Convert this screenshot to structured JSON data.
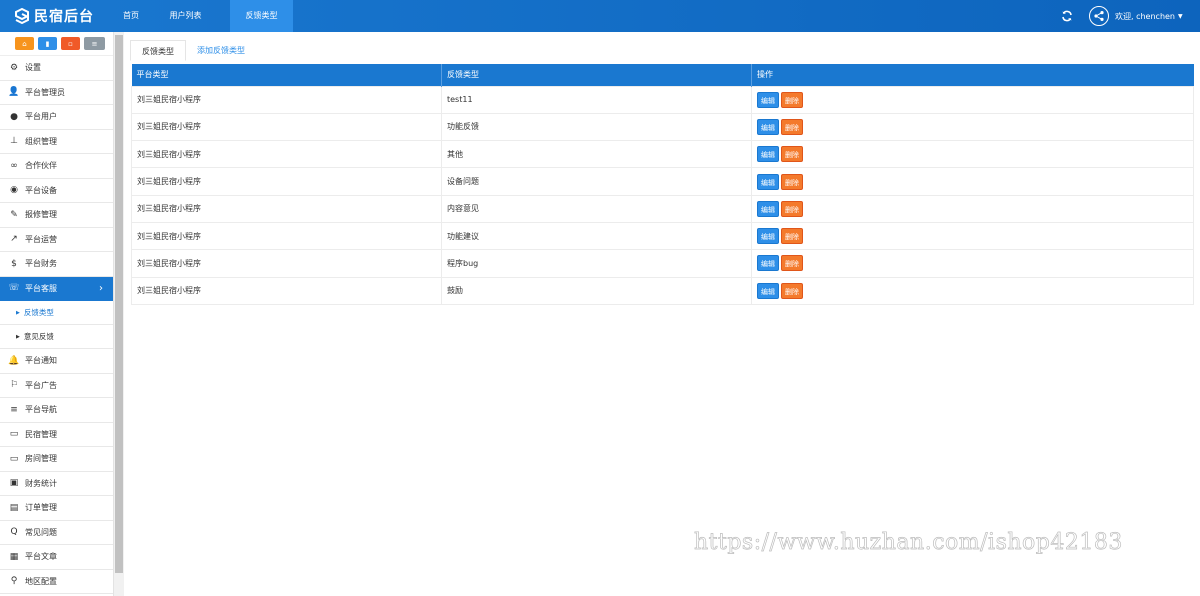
{
  "header": {
    "logo_text": "民宿后台",
    "nav": [
      {
        "label": "首页"
      },
      {
        "label": "用户列表"
      },
      {
        "label": "反馈类型"
      }
    ],
    "welcome": "欢迎, chenchen"
  },
  "sidebar": {
    "quick_buttons": [
      "home-icon",
      "file-icon",
      "trash-icon",
      "list-icon"
    ],
    "items": [
      {
        "label": "设置",
        "icon": "gears-icon"
      },
      {
        "label": "平台管理员",
        "icon": "user-add-icon"
      },
      {
        "label": "平台用户",
        "icon": "user-icon"
      },
      {
        "label": "组织管理",
        "icon": "sitemap-icon"
      },
      {
        "label": "合作伙伴",
        "icon": "handshake-icon"
      },
      {
        "label": "平台设备",
        "icon": "device-icon"
      },
      {
        "label": "报修管理",
        "icon": "wrench-icon"
      },
      {
        "label": "平台运营",
        "icon": "line-chart-icon"
      },
      {
        "label": "平台财务",
        "icon": "dollar-icon"
      },
      {
        "label": "平台客服",
        "icon": "phone-icon"
      }
    ],
    "sub_items": [
      {
        "label": "反馈类型"
      },
      {
        "label": "意见反馈"
      }
    ],
    "items_after": [
      {
        "label": "平台通知",
        "icon": "bell-icon"
      },
      {
        "label": "平台广告",
        "icon": "flag-icon"
      },
      {
        "label": "平台导航",
        "icon": "bars-icon"
      },
      {
        "label": "民宿管理",
        "icon": "monitor-icon"
      },
      {
        "label": "房间管理",
        "icon": "monitor-icon"
      },
      {
        "label": "财务统计",
        "icon": "photo-icon"
      },
      {
        "label": "订单管理",
        "icon": "id-card-icon"
      },
      {
        "label": "常见问题",
        "icon": "question-icon"
      },
      {
        "label": "平台文章",
        "icon": "grid-icon"
      },
      {
        "label": "地区配置",
        "icon": "map-marker-icon"
      }
    ]
  },
  "tabs": [
    {
      "label": "反馈类型"
    },
    {
      "label": "添加反馈类型"
    }
  ],
  "table": {
    "headers": [
      "平台类型",
      "反馈类型",
      "操作"
    ],
    "rows": [
      [
        "刘三姐民宿小程序",
        "test11"
      ],
      [
        "刘三姐民宿小程序",
        "功能反馈"
      ],
      [
        "刘三姐民宿小程序",
        "其他"
      ],
      [
        "刘三姐民宿小程序",
        "设备问题"
      ],
      [
        "刘三姐民宿小程序",
        "内容意见"
      ],
      [
        "刘三姐民宿小程序",
        "功能建议"
      ],
      [
        "刘三姐民宿小程序",
        "程序bug"
      ],
      [
        "刘三姐民宿小程序",
        "鼓励"
      ]
    ],
    "edit_label": "编辑",
    "delete_label": "删除"
  },
  "watermark": "https://www.huzhan.com/ishop42183"
}
